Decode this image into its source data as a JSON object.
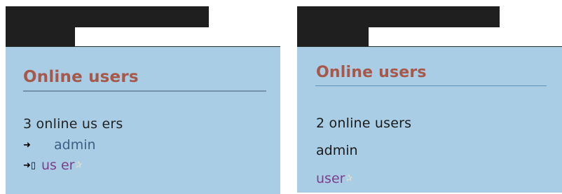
{
  "left_panel": {
    "title": "Online users",
    "count_text": "3 online us ers",
    "users": [
      {
        "name": "admin",
        "icons": [
          "arrow-icon"
        ]
      },
      {
        "name": "us er",
        "icons": [
          "arrow-icon",
          "document-icon"
        ],
        "has_star": true
      }
    ]
  },
  "right_panel": {
    "title": "Online users",
    "count_text": "2 online users",
    "users": [
      {
        "name": "admin"
      },
      {
        "name": "user",
        "has_star": true
      }
    ]
  },
  "colors": {
    "block_background": "#a9cde4",
    "title": "#a6584a",
    "admin_link": "#3c5f86",
    "user_link": "#7a3e8c",
    "header_bar": "#1f1f1f"
  }
}
